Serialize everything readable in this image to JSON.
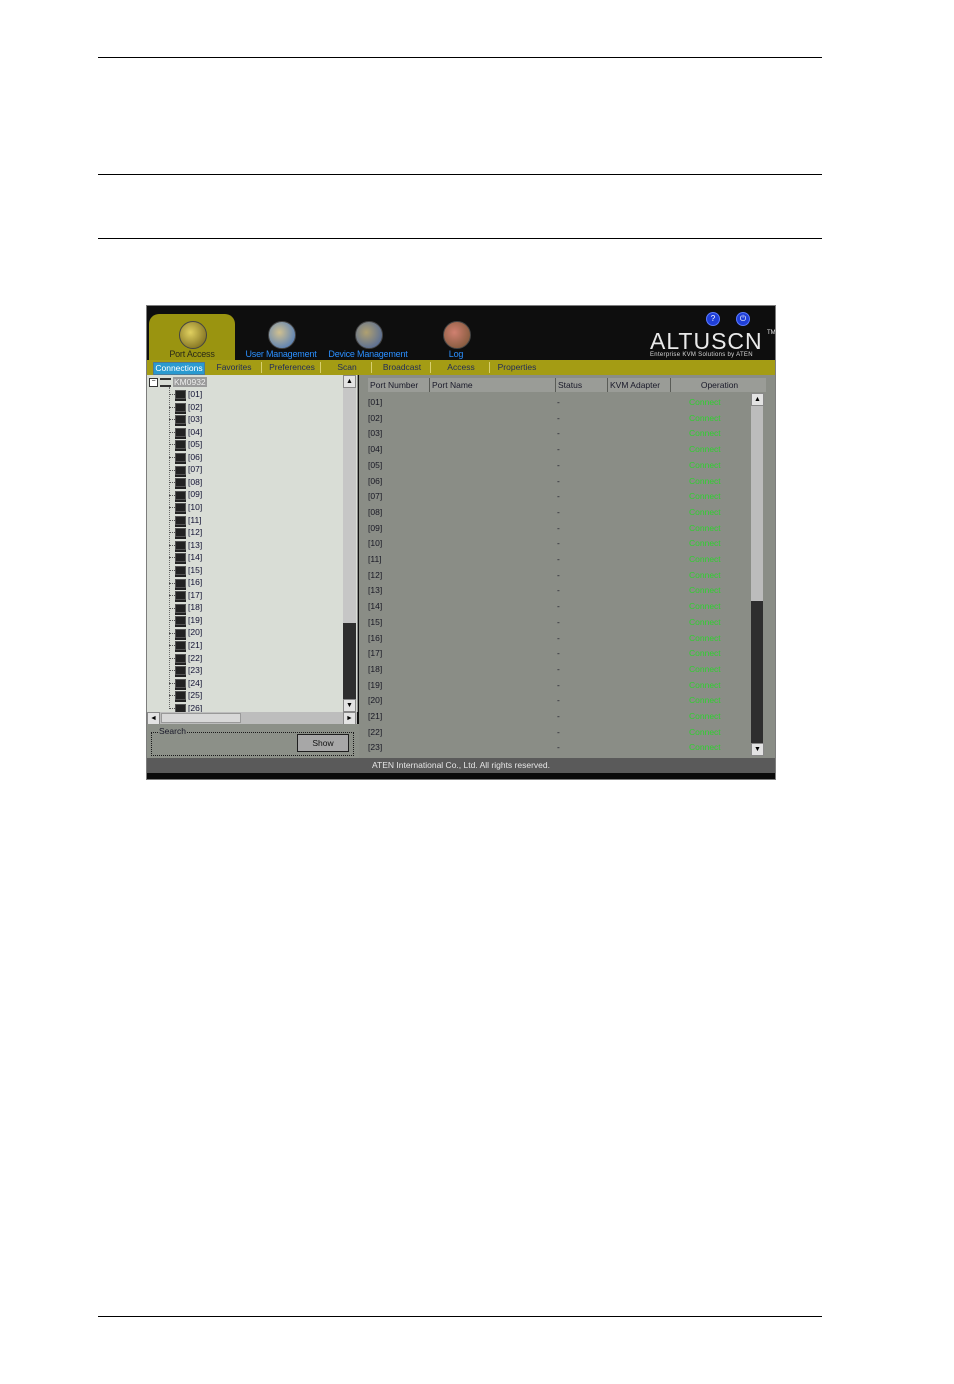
{
  "header": {
    "nav": [
      {
        "id": "port",
        "label": "Port Access",
        "icon": "port-access-icon"
      },
      {
        "id": "user",
        "label": "User Management",
        "icon": "user-management-icon"
      },
      {
        "id": "device",
        "label": "Device Management",
        "icon": "device-management-icon"
      },
      {
        "id": "log",
        "label": "Log",
        "icon": "log-icon"
      }
    ],
    "help_icon": "?",
    "logout_icon": "⏻",
    "logo": "ALTUSCN",
    "logo_tm": "TM",
    "tagline": "Enterprise KVM Solutions by ATEN"
  },
  "tabs": [
    "Connections",
    "Favorites",
    "Preferences",
    "Scan",
    "Broadcast",
    "Access",
    "Properties"
  ],
  "active_tab": "Connections",
  "tree": {
    "root": "KM0932",
    "ports": [
      "[01]",
      "[02]",
      "[03]",
      "[04]",
      "[05]",
      "[06]",
      "[07]",
      "[08]",
      "[09]",
      "[10]",
      "[11]",
      "[12]",
      "[13]",
      "[14]",
      "[15]",
      "[16]",
      "[17]",
      "[18]",
      "[19]",
      "[20]",
      "[21]",
      "[22]",
      "[23]",
      "[24]",
      "[25]",
      "[26]"
    ]
  },
  "search": {
    "label": "Search",
    "show_label": "Show"
  },
  "table": {
    "columns": [
      "Port Number",
      "Port Name",
      "Status",
      "KVM Adapter",
      "Operation"
    ],
    "rows": [
      {
        "port": "[01]",
        "name": "",
        "status": "-",
        "adapter": "",
        "op": "Connect"
      },
      {
        "port": "[02]",
        "name": "",
        "status": "-",
        "adapter": "",
        "op": "Connect"
      },
      {
        "port": "[03]",
        "name": "",
        "status": "-",
        "adapter": "",
        "op": "Connect"
      },
      {
        "port": "[04]",
        "name": "",
        "status": "-",
        "adapter": "",
        "op": "Connect"
      },
      {
        "port": "[05]",
        "name": "",
        "status": "-",
        "adapter": "",
        "op": "Connect"
      },
      {
        "port": "[06]",
        "name": "",
        "status": "-",
        "adapter": "",
        "op": "Connect"
      },
      {
        "port": "[07]",
        "name": "",
        "status": "-",
        "adapter": "",
        "op": "Connect"
      },
      {
        "port": "[08]",
        "name": "",
        "status": "-",
        "adapter": "",
        "op": "Connect"
      },
      {
        "port": "[09]",
        "name": "",
        "status": "-",
        "adapter": "",
        "op": "Connect"
      },
      {
        "port": "[10]",
        "name": "",
        "status": "-",
        "adapter": "",
        "op": "Connect"
      },
      {
        "port": "[11]",
        "name": "",
        "status": "-",
        "adapter": "",
        "op": "Connect"
      },
      {
        "port": "[12]",
        "name": "",
        "status": "-",
        "adapter": "",
        "op": "Connect"
      },
      {
        "port": "[13]",
        "name": "",
        "status": "-",
        "adapter": "",
        "op": "Connect"
      },
      {
        "port": "[14]",
        "name": "",
        "status": "-",
        "adapter": "",
        "op": "Connect"
      },
      {
        "port": "[15]",
        "name": "",
        "status": "-",
        "adapter": "",
        "op": "Connect"
      },
      {
        "port": "[16]",
        "name": "",
        "status": "-",
        "adapter": "",
        "op": "Connect"
      },
      {
        "port": "[17]",
        "name": "",
        "status": "-",
        "adapter": "",
        "op": "Connect"
      },
      {
        "port": "[18]",
        "name": "",
        "status": "-",
        "adapter": "",
        "op": "Connect"
      },
      {
        "port": "[19]",
        "name": "",
        "status": "-",
        "adapter": "",
        "op": "Connect"
      },
      {
        "port": "[20]",
        "name": "",
        "status": "-",
        "adapter": "",
        "op": "Connect"
      },
      {
        "port": "[21]",
        "name": "",
        "status": "-",
        "adapter": "",
        "op": "Connect"
      },
      {
        "port": "[22]",
        "name": "",
        "status": "-",
        "adapter": "",
        "op": "Connect"
      },
      {
        "port": "[23]",
        "name": "",
        "status": "-",
        "adapter": "",
        "op": "Connect"
      }
    ]
  },
  "scroll": {
    "up": "▲",
    "down": "▼",
    "left": "◄",
    "right": "►"
  },
  "status_bar": "ATEN International Co., Ltd. All rights reserved.",
  "colors": {
    "accent": "#a49c14",
    "connect": "#2fd02f",
    "nav_label": "#2b8fff"
  }
}
